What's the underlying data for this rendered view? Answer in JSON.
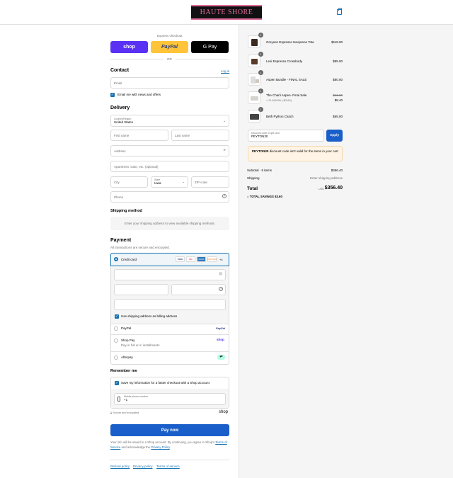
{
  "header": {
    "logo_text": "HAUTE SHORE"
  },
  "express": {
    "title": "Express checkout",
    "shop": "shop",
    "paypal": "PayPal",
    "gpay": "G Pay",
    "or": "OR"
  },
  "contact": {
    "title": "Contact",
    "login": "Log in",
    "email_placeholder": "Email",
    "news_label": "Email me with news and offers"
  },
  "delivery": {
    "title": "Delivery",
    "country_label": "Country/Region",
    "country_value": "United States",
    "first_name": "First name",
    "last_name": "Last name",
    "address": "Address",
    "apartment": "Apartment, suite, etc. (optional)",
    "city": "City",
    "state_label": "State",
    "state_value": "Iowa",
    "zip": "ZIP code",
    "phone": "Phone"
  },
  "shipping": {
    "title": "Shipping method",
    "message": "Enter your shipping address to view available shipping methods."
  },
  "payment": {
    "title": "Payment",
    "subtitle": "All transactions are secure and encrypted.",
    "credit_card": "Credit card",
    "card_brands": [
      "VISA",
      "MC",
      "AMEX",
      "DISCOVER",
      "+4"
    ],
    "billing_same": "Use shipping address as billing address",
    "paypal": "PayPal",
    "paypal_logo": "PayPal",
    "shoppay": "Shop Pay",
    "shoppay_sub": "Pay in full or in installments",
    "shoppay_logo": "shop",
    "afterpay": "Afterpay"
  },
  "remember": {
    "title": "Remember me",
    "save_label": "Save my information for a faster checkout with a Shop account",
    "phone_label": "Mobile phone number",
    "phone_value": "+1",
    "secure": "Secure and encrypted",
    "shop_logo": "shop"
  },
  "paynow": "Pay now",
  "terms": {
    "line1": "Your info will be saved to a Shop account. By continuing, you agree to Shop's",
    "tos": "Terms of Service",
    "and": "and acknowledge the",
    "privacy": "Privacy Policy",
    "end": "."
  },
  "footer": [
    "Refund policy",
    "Privacy policy",
    "Terms of service"
  ],
  "cart": {
    "items": [
      {
        "qty": "1",
        "name": "Greyson Espresso Neoprene Tote",
        "price": "$118.00"
      },
      {
        "qty": "1",
        "name": "Lexi Espresso Crossbody",
        "price": "$85.00"
      },
      {
        "qty": "1",
        "name": "Aspen Bundle - FINAL SALE",
        "price": "$80.00"
      },
      {
        "qty": "1",
        "name": "The Charli Aspen- Final Sale",
        "old_price": "$13.00",
        "discount": "FLASH30 (-$3.60)",
        "price": "$8.40"
      },
      {
        "qty": "1",
        "name": "Beth Python Clutch",
        "price": "$65.00"
      }
    ],
    "discount_label": "Discount code or gift card",
    "discount_value": "PEYTON30",
    "apply": "Apply",
    "warning_code": "PEYTON30",
    "warning_text": "discount code isn't valid for the items in your cart",
    "subtotal_label": "Subtotal · 5 items",
    "subtotal": "$356.40",
    "shipping_label": "Shipping",
    "shipping_value": "Enter shipping address",
    "total_label": "Total",
    "currency": "USD",
    "total": "$356.40",
    "savings_label": "TOTAL SAVINGS",
    "savings": "$3.60"
  }
}
